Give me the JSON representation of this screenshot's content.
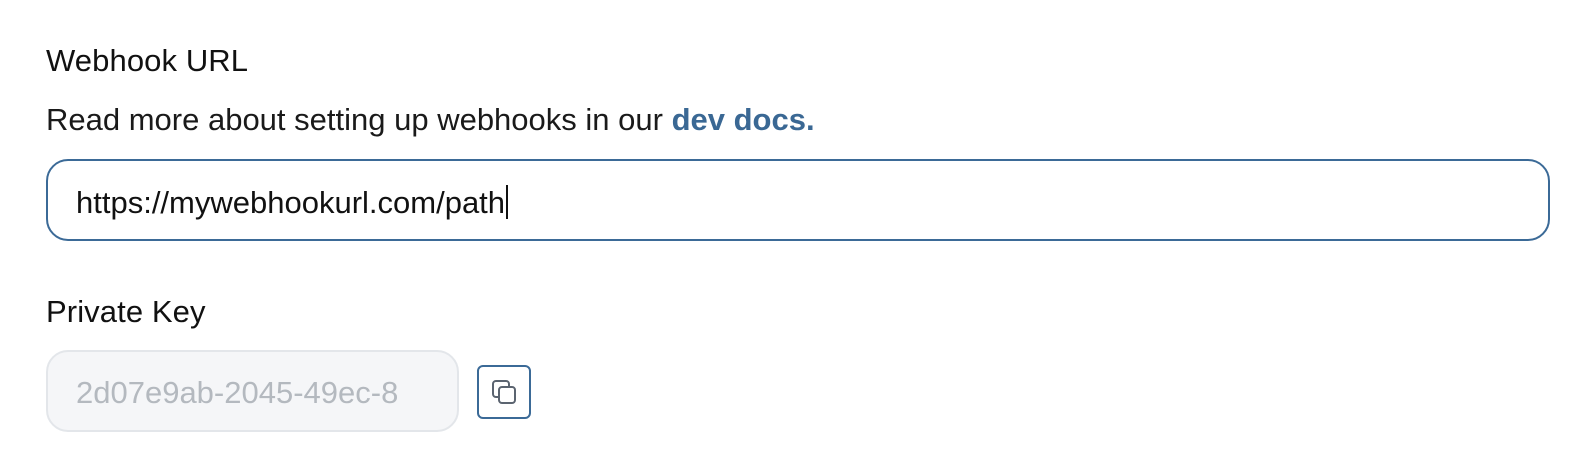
{
  "webhook": {
    "title": "Webhook URL",
    "helper_prefix": "Read more about setting up webhooks in our ",
    "helper_link": "dev docs.",
    "url_value": "https://mywebhookurl.com/path"
  },
  "private_key": {
    "title": "Private Key",
    "value": "2d07e9ab-2045-49ec-8"
  },
  "colors": {
    "accent": "#3b6a97",
    "link": "#3a6894",
    "disabled_text": "#b4b9bf",
    "disabled_bg": "#f5f6f8"
  },
  "icons": {
    "copy_button": "copy-icon"
  }
}
